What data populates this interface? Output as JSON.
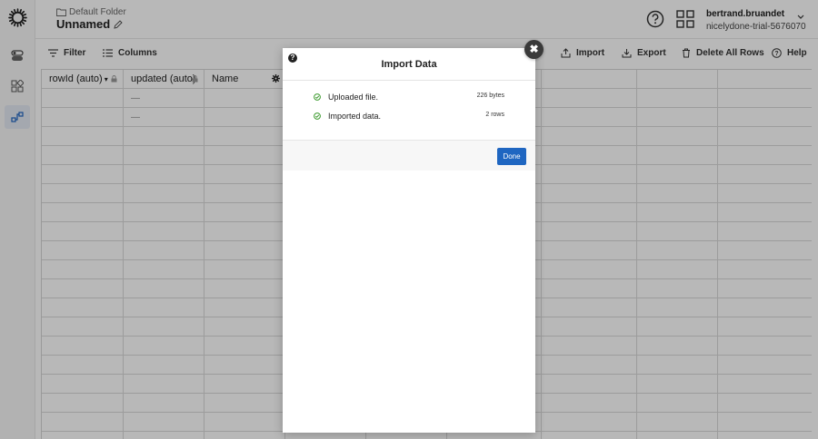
{
  "header": {
    "breadcrumb": "Default Folder",
    "title": "Unnamed",
    "user_name": "bertrand.bruandet",
    "user_org": "nicelydone-trial-5676070"
  },
  "toolbar": {
    "filter_label": "Filter",
    "columns_label": "Columns",
    "import_label": "Import",
    "export_label": "Export",
    "delete_all_label": "Delete All Rows",
    "help_label": "Help"
  },
  "grid": {
    "columns": [
      "rowId (auto)",
      "updated (auto)",
      "Name"
    ],
    "rows": [
      {
        "rowId": "",
        "updated": "—",
        "name": ""
      },
      {
        "rowId": "",
        "updated": "—",
        "name": ""
      }
    ]
  },
  "modal": {
    "title": "Import Data",
    "help_glyph": "?",
    "close_glyph": "✖",
    "steps": [
      {
        "label": "Uploaded file.",
        "meta": "226 bytes"
      },
      {
        "label": "Imported data.",
        "meta": "2 rows"
      }
    ],
    "done_label": "Done"
  },
  "colors": {
    "accent": "#1f66c1",
    "success": "#3c9a2e",
    "overlay": "rgba(0,0,0,0.28)"
  },
  "icons": [
    "logo-icon",
    "toggle-icon",
    "apps-small-icon",
    "flow-icon",
    "folder-icon",
    "edit-icon",
    "help-circle-icon",
    "grid-apps-icon",
    "chevron-down-icon",
    "filter-icon",
    "columns-icon",
    "import-icon",
    "export-icon",
    "trash-icon",
    "lock-icon",
    "gear-icon",
    "check-circle-icon",
    "close-icon"
  ]
}
